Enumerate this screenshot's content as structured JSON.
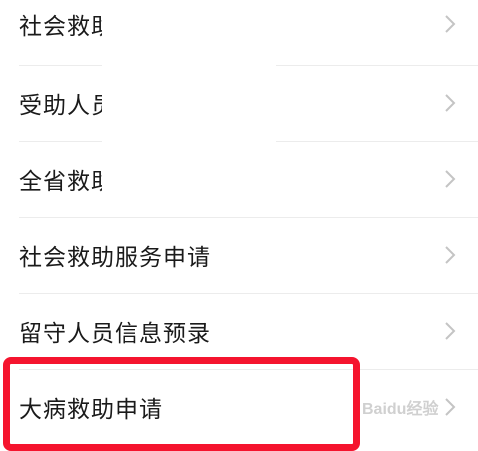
{
  "list": {
    "items": [
      {
        "label": "社会救助"
      },
      {
        "label": "受助人员"
      },
      {
        "label": "全省救助"
      },
      {
        "label": "社会救助服务申请"
      },
      {
        "label": "留守人员信息预录"
      },
      {
        "label": "大病救助申请"
      }
    ]
  },
  "icons": {
    "chevron": "chevron-right-icon"
  },
  "colors": {
    "highlight": "#f5142e",
    "text": "#1a1a1a",
    "chevron": "#c4c4c4",
    "divider": "#ececec"
  },
  "watermark": {
    "text": "Baidu经验"
  }
}
